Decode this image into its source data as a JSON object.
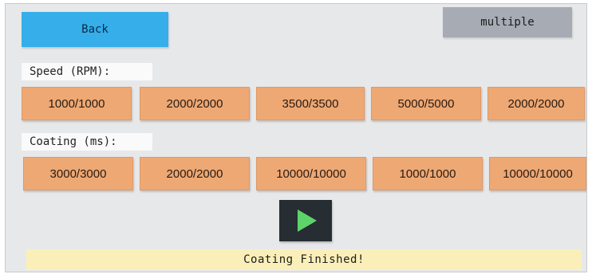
{
  "header": {
    "back_label": "Back",
    "multiple_label": "multiple"
  },
  "speed": {
    "label": "Speed (RPM):",
    "options": [
      "1000/1000",
      "2000/2000",
      "3500/3500",
      "5000/5000",
      "2000/2000"
    ]
  },
  "coating": {
    "label": "Coating (ms):",
    "options": [
      "3000/3000",
      "2000/2000",
      "10000/10000",
      "1000/1000",
      "10000/10000"
    ]
  },
  "controls": {
    "play_icon": "play-icon"
  },
  "status": {
    "text": "Coating Finished!"
  },
  "colors": {
    "back_button": "#35aeea",
    "multiple_button": "#a6abb4",
    "preset_button": "#eda874",
    "play_button_bg": "#262d33",
    "play_icon": "#5ed36a",
    "status_bar": "#fbefb9"
  }
}
